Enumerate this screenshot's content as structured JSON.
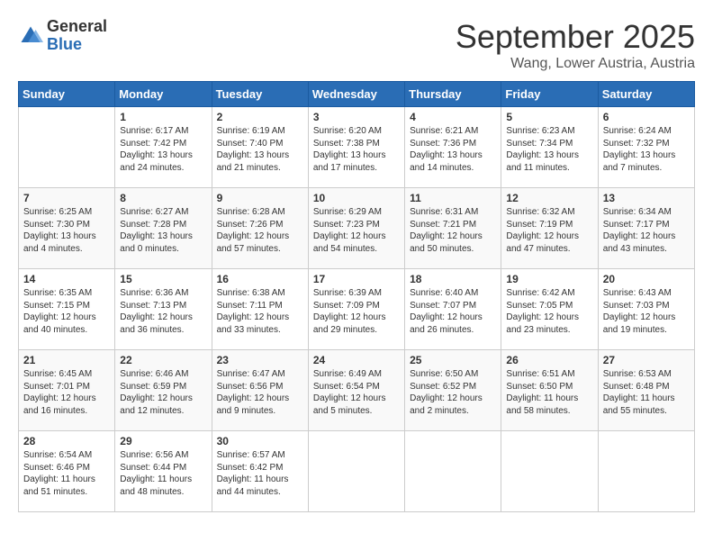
{
  "header": {
    "logo_general": "General",
    "logo_blue": "Blue",
    "month_title": "September 2025",
    "location": "Wang, Lower Austria, Austria"
  },
  "days_of_week": [
    "Sunday",
    "Monday",
    "Tuesday",
    "Wednesday",
    "Thursday",
    "Friday",
    "Saturday"
  ],
  "weeks": [
    [
      {
        "num": "",
        "info": ""
      },
      {
        "num": "1",
        "info": "Sunrise: 6:17 AM\nSunset: 7:42 PM\nDaylight: 13 hours\nand 24 minutes."
      },
      {
        "num": "2",
        "info": "Sunrise: 6:19 AM\nSunset: 7:40 PM\nDaylight: 13 hours\nand 21 minutes."
      },
      {
        "num": "3",
        "info": "Sunrise: 6:20 AM\nSunset: 7:38 PM\nDaylight: 13 hours\nand 17 minutes."
      },
      {
        "num": "4",
        "info": "Sunrise: 6:21 AM\nSunset: 7:36 PM\nDaylight: 13 hours\nand 14 minutes."
      },
      {
        "num": "5",
        "info": "Sunrise: 6:23 AM\nSunset: 7:34 PM\nDaylight: 13 hours\nand 11 minutes."
      },
      {
        "num": "6",
        "info": "Sunrise: 6:24 AM\nSunset: 7:32 PM\nDaylight: 13 hours\nand 7 minutes."
      }
    ],
    [
      {
        "num": "7",
        "info": "Sunrise: 6:25 AM\nSunset: 7:30 PM\nDaylight: 13 hours\nand 4 minutes."
      },
      {
        "num": "8",
        "info": "Sunrise: 6:27 AM\nSunset: 7:28 PM\nDaylight: 13 hours\nand 0 minutes."
      },
      {
        "num": "9",
        "info": "Sunrise: 6:28 AM\nSunset: 7:26 PM\nDaylight: 12 hours\nand 57 minutes."
      },
      {
        "num": "10",
        "info": "Sunrise: 6:29 AM\nSunset: 7:23 PM\nDaylight: 12 hours\nand 54 minutes."
      },
      {
        "num": "11",
        "info": "Sunrise: 6:31 AM\nSunset: 7:21 PM\nDaylight: 12 hours\nand 50 minutes."
      },
      {
        "num": "12",
        "info": "Sunrise: 6:32 AM\nSunset: 7:19 PM\nDaylight: 12 hours\nand 47 minutes."
      },
      {
        "num": "13",
        "info": "Sunrise: 6:34 AM\nSunset: 7:17 PM\nDaylight: 12 hours\nand 43 minutes."
      }
    ],
    [
      {
        "num": "14",
        "info": "Sunrise: 6:35 AM\nSunset: 7:15 PM\nDaylight: 12 hours\nand 40 minutes."
      },
      {
        "num": "15",
        "info": "Sunrise: 6:36 AM\nSunset: 7:13 PM\nDaylight: 12 hours\nand 36 minutes."
      },
      {
        "num": "16",
        "info": "Sunrise: 6:38 AM\nSunset: 7:11 PM\nDaylight: 12 hours\nand 33 minutes."
      },
      {
        "num": "17",
        "info": "Sunrise: 6:39 AM\nSunset: 7:09 PM\nDaylight: 12 hours\nand 29 minutes."
      },
      {
        "num": "18",
        "info": "Sunrise: 6:40 AM\nSunset: 7:07 PM\nDaylight: 12 hours\nand 26 minutes."
      },
      {
        "num": "19",
        "info": "Sunrise: 6:42 AM\nSunset: 7:05 PM\nDaylight: 12 hours\nand 23 minutes."
      },
      {
        "num": "20",
        "info": "Sunrise: 6:43 AM\nSunset: 7:03 PM\nDaylight: 12 hours\nand 19 minutes."
      }
    ],
    [
      {
        "num": "21",
        "info": "Sunrise: 6:45 AM\nSunset: 7:01 PM\nDaylight: 12 hours\nand 16 minutes."
      },
      {
        "num": "22",
        "info": "Sunrise: 6:46 AM\nSunset: 6:59 PM\nDaylight: 12 hours\nand 12 minutes."
      },
      {
        "num": "23",
        "info": "Sunrise: 6:47 AM\nSunset: 6:56 PM\nDaylight: 12 hours\nand 9 minutes."
      },
      {
        "num": "24",
        "info": "Sunrise: 6:49 AM\nSunset: 6:54 PM\nDaylight: 12 hours\nand 5 minutes."
      },
      {
        "num": "25",
        "info": "Sunrise: 6:50 AM\nSunset: 6:52 PM\nDaylight: 12 hours\nand 2 minutes."
      },
      {
        "num": "26",
        "info": "Sunrise: 6:51 AM\nSunset: 6:50 PM\nDaylight: 11 hours\nand 58 minutes."
      },
      {
        "num": "27",
        "info": "Sunrise: 6:53 AM\nSunset: 6:48 PM\nDaylight: 11 hours\nand 55 minutes."
      }
    ],
    [
      {
        "num": "28",
        "info": "Sunrise: 6:54 AM\nSunset: 6:46 PM\nDaylight: 11 hours\nand 51 minutes."
      },
      {
        "num": "29",
        "info": "Sunrise: 6:56 AM\nSunset: 6:44 PM\nDaylight: 11 hours\nand 48 minutes."
      },
      {
        "num": "30",
        "info": "Sunrise: 6:57 AM\nSunset: 6:42 PM\nDaylight: 11 hours\nand 44 minutes."
      },
      {
        "num": "",
        "info": ""
      },
      {
        "num": "",
        "info": ""
      },
      {
        "num": "",
        "info": ""
      },
      {
        "num": "",
        "info": ""
      }
    ]
  ]
}
